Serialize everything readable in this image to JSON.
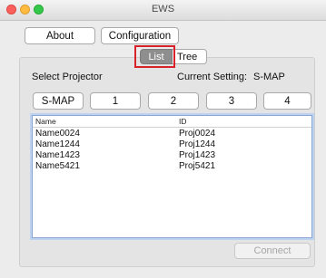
{
  "window": {
    "title": "EWS"
  },
  "toolbar": {
    "about_label": "About",
    "configuration_label": "Configuration"
  },
  "view_tabs": {
    "list_label": "List",
    "tree_label": "Tree",
    "selected": "List"
  },
  "projector": {
    "select_label": "Select Projector",
    "current_setting_label": "Current Setting:",
    "current_setting_value": "S-MAP",
    "buttons": [
      "S-MAP",
      "1",
      "2",
      "3",
      "4"
    ]
  },
  "table": {
    "columns": [
      "Name",
      "ID"
    ],
    "rows": [
      {
        "name": "Name0024",
        "id": "Proj0024"
      },
      {
        "name": "Name1244",
        "id": "Proj1244"
      },
      {
        "name": "Name1423",
        "id": "Proj1423"
      },
      {
        "name": "Name5421",
        "id": "Proj5421"
      }
    ]
  },
  "actions": {
    "connect_label": "Connect",
    "connect_enabled": false
  },
  "colors": {
    "highlight": "#d9212b",
    "selected_tab": "#8e8e8e",
    "focus_ring": "#bcd2f0"
  },
  "icons": [
    "close-icon",
    "minimize-icon",
    "zoom-icon"
  ]
}
